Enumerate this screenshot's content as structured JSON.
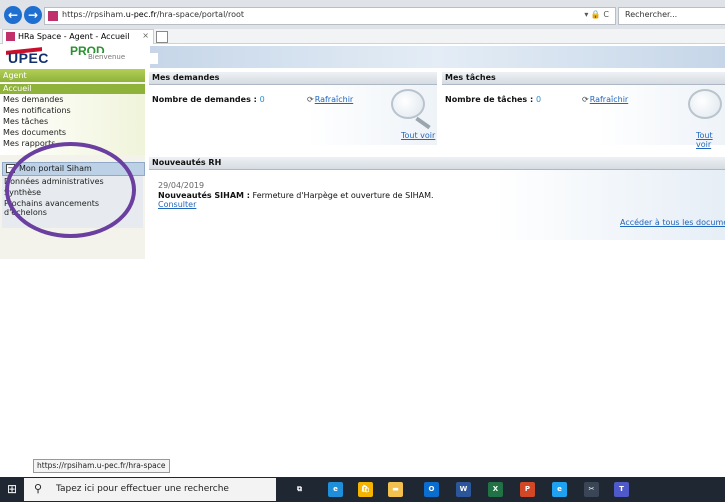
{
  "browser": {
    "url_prefix": "https://rpsiham.",
    "url_domain": "u-pec.fr",
    "url_path": "/hra-space/portal/root",
    "search_placeholder": "Rechercher...",
    "tab_title": "HRa Space - Agent - Accueil",
    "tab_close": "×",
    "back_glyph": "←",
    "forward_glyph": "→",
    "addr_icons": "▾ 🔒 C"
  },
  "app": {
    "logo": "UPEC",
    "env": "PROD",
    "welcome": "Bienvenue"
  },
  "sidebar": {
    "header": "Agent",
    "items": [
      {
        "label": "Accueil",
        "active": true
      },
      {
        "label": "Mes demandes"
      },
      {
        "label": "Mes notifications"
      },
      {
        "label": "Mes tâches"
      },
      {
        "label": "Mes documents"
      },
      {
        "label": "Mes rapports"
      }
    ],
    "portal": {
      "toggle": "−",
      "title": "Mon portail Siham",
      "items": [
        "Données administratives",
        "Synthèse",
        "Prochains avancements",
        "d'échelons"
      ]
    }
  },
  "demandes": {
    "title": "Mes demandes",
    "count_label": "Nombre de demandes :",
    "count": "0",
    "refresh": "Rafraîchir",
    "see_all": "Tout voir"
  },
  "taches": {
    "title": "Mes tâches",
    "count_label": "Nombre de tâches :",
    "count": "0",
    "refresh": "Rafraîchir",
    "see_all": "Tout voir"
  },
  "news": {
    "title": "Nouveautés RH",
    "date": "29/04/2019",
    "headline_bold": "Nouveautés SIHAM :",
    "headline_text": " Fermeture d'Harpège et ouverture de SIHAM.",
    "consult": "Consulter",
    "all_docs": "Accéder à tous les documents"
  },
  "status_url": "https://rpsiham.u-pec.fr/hra-space",
  "taskbar": {
    "start_glyph": "⊞",
    "search_glyph": "⚲",
    "search_placeholder": "Tapez ici pour effectuer une recherche",
    "apps": [
      {
        "name": "task-view",
        "glyph": "⧉",
        "color": "#1f2733"
      },
      {
        "name": "edge",
        "glyph": "e",
        "color": "#1e8fd8"
      },
      {
        "name": "store",
        "glyph": "🛍",
        "color": "#f4b400"
      },
      {
        "name": "explorer",
        "glyph": "▬",
        "color": "#f2c14e"
      },
      {
        "name": "outlook",
        "glyph": "O",
        "color": "#0a6ed1"
      },
      {
        "name": "word",
        "glyph": "W",
        "color": "#2b579a"
      },
      {
        "name": "excel",
        "glyph": "X",
        "color": "#217346"
      },
      {
        "name": "powerpoint",
        "glyph": "P",
        "color": "#d24726"
      },
      {
        "name": "internet-explorer",
        "glyph": "e",
        "color": "#1ea1f1"
      },
      {
        "name": "snipping",
        "glyph": "✂",
        "color": "#3a4656"
      },
      {
        "name": "teams",
        "glyph": "T",
        "color": "#5059c9"
      }
    ]
  }
}
